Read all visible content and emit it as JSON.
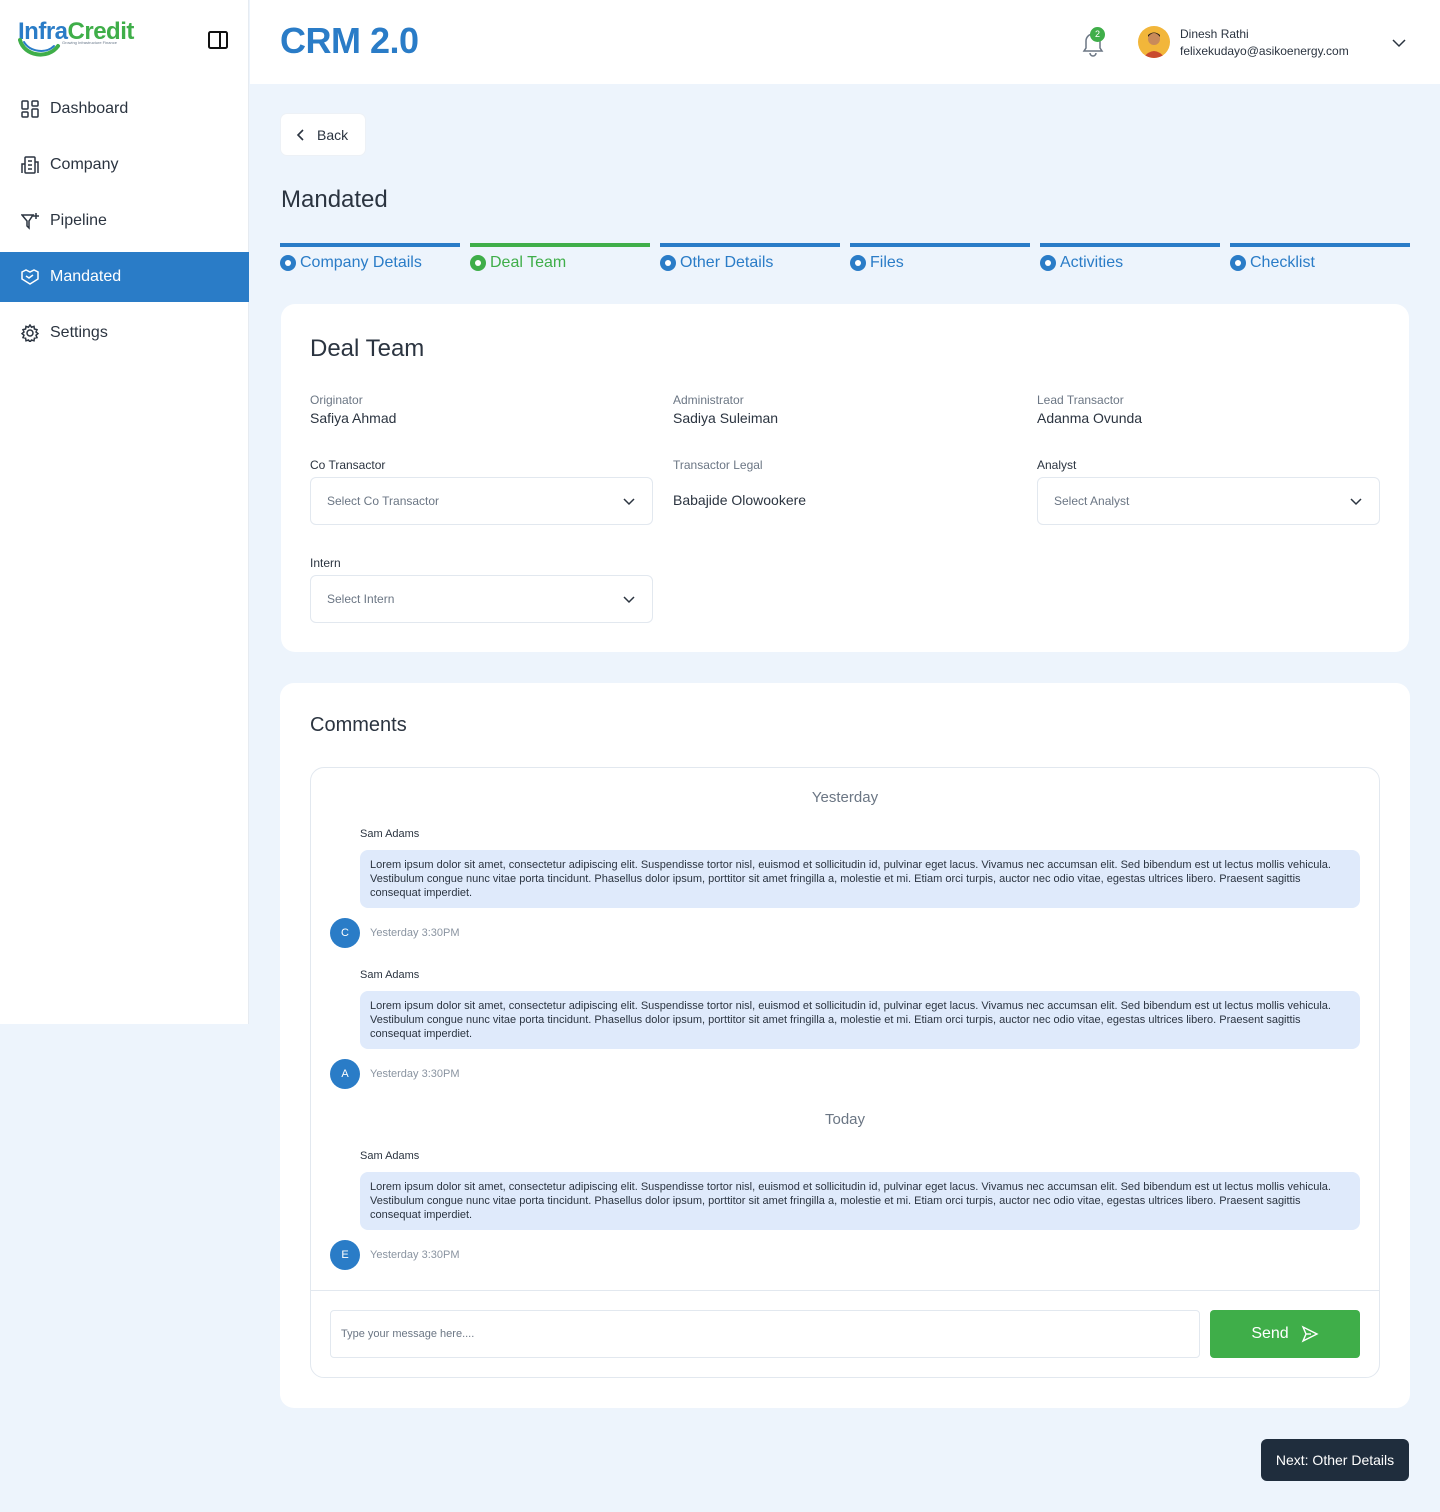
{
  "brand": {
    "logo_part1": "Infra",
    "logo_part2": "Credit",
    "logo_tagline": "Growing Infrastructure Finance"
  },
  "sidebar": {
    "items": [
      {
        "label": "Dashboard",
        "icon": "dashboard-icon"
      },
      {
        "label": "Company",
        "icon": "building-icon"
      },
      {
        "label": "Pipeline",
        "icon": "filter-icon"
      },
      {
        "label": "Mandated",
        "icon": "handshake-icon",
        "active": true
      },
      {
        "label": "Settings",
        "icon": "gear-icon"
      }
    ]
  },
  "header": {
    "title": "CRM 2.0",
    "notification_count": "2",
    "user_name": "Dinesh Rathi",
    "user_email": "felixekudayo@asikoenergy.com"
  },
  "back_label": "Back",
  "page_title": "Mandated",
  "steps": [
    "Company Details",
    "Deal Team",
    "Other Details",
    "Files",
    "Activities",
    "Checklist"
  ],
  "deal_team": {
    "title": "Deal Team",
    "originator_label": "Originator",
    "originator_value": "Safiya Ahmad",
    "administrator_label": "Administrator",
    "administrator_value": "Sadiya Suleiman",
    "lead_transactor_label": "Lead Transactor",
    "lead_transactor_value": "Adanma Ovunda",
    "co_transactor_label": "Co Transactor",
    "co_transactor_placeholder": "Select Co Transactor",
    "transactor_legal_label": "Transactor Legal",
    "transactor_legal_value": "Babajide Olowookere",
    "analyst_label": "Analyst",
    "analyst_placeholder": "Select Analyst",
    "intern_label": "Intern",
    "intern_placeholder": "Select Intern"
  },
  "comments": {
    "title": "Comments",
    "day1": "Yesterday",
    "day2": "Today",
    "messages": [
      {
        "author": "Sam Adams",
        "initial": "C",
        "time": "Yesterday 3:30PM",
        "text": "Lorem ipsum dolor sit amet, consectetur adipiscing elit. Suspendisse tortor nisl, euismod et sollicitudin id, pulvinar eget lacus. Vivamus nec accumsan elit. Sed bibendum est ut lectus mollis vehicula. Vestibulum congue nunc vitae porta tincidunt. Phasellus dolor ipsum, porttitor sit amet fringilla a, molestie et mi. Etiam orci turpis, auctor nec odio vitae, egestas ultrices libero. Praesent sagittis consequat imperdiet."
      },
      {
        "author": "Sam Adams",
        "initial": "A",
        "time": "Yesterday 3:30PM",
        "text": "Lorem ipsum dolor sit amet, consectetur adipiscing elit. Suspendisse tortor nisl, euismod et sollicitudin id, pulvinar eget lacus. Vivamus nec accumsan elit. Sed bibendum est ut lectus mollis vehicula. Vestibulum congue nunc vitae porta tincidunt. Phasellus dolor ipsum, porttitor sit amet fringilla a, molestie et mi. Etiam orci turpis, auctor nec odio vitae, egestas ultrices libero. Praesent sagittis consequat imperdiet."
      },
      {
        "author": "Sam Adams",
        "initial": "E",
        "time": "Yesterday 3:30PM",
        "text": "Lorem ipsum dolor sit amet, consectetur adipiscing elit. Suspendisse tortor nisl, euismod et sollicitudin id, pulvinar eget lacus. Vivamus nec accumsan elit. Sed bibendum est ut lectus mollis vehicula. Vestibulum congue nunc vitae porta tincidunt. Phasellus dolor ipsum, porttitor sit amet fringilla a, molestie et mi. Etiam orci turpis, auctor nec odio vitae, egestas ultrices libero. Praesent sagittis consequat imperdiet."
      }
    ],
    "input_placeholder": "Type your message here....",
    "send_label": "Send"
  },
  "next_label": "Next: Other Details",
  "colors": {
    "primary": "#2a7cc7",
    "success": "#3fae49",
    "background": "#edf4fc",
    "dark_button": "#1f2d3d",
    "bubble": "#dfeafb"
  }
}
